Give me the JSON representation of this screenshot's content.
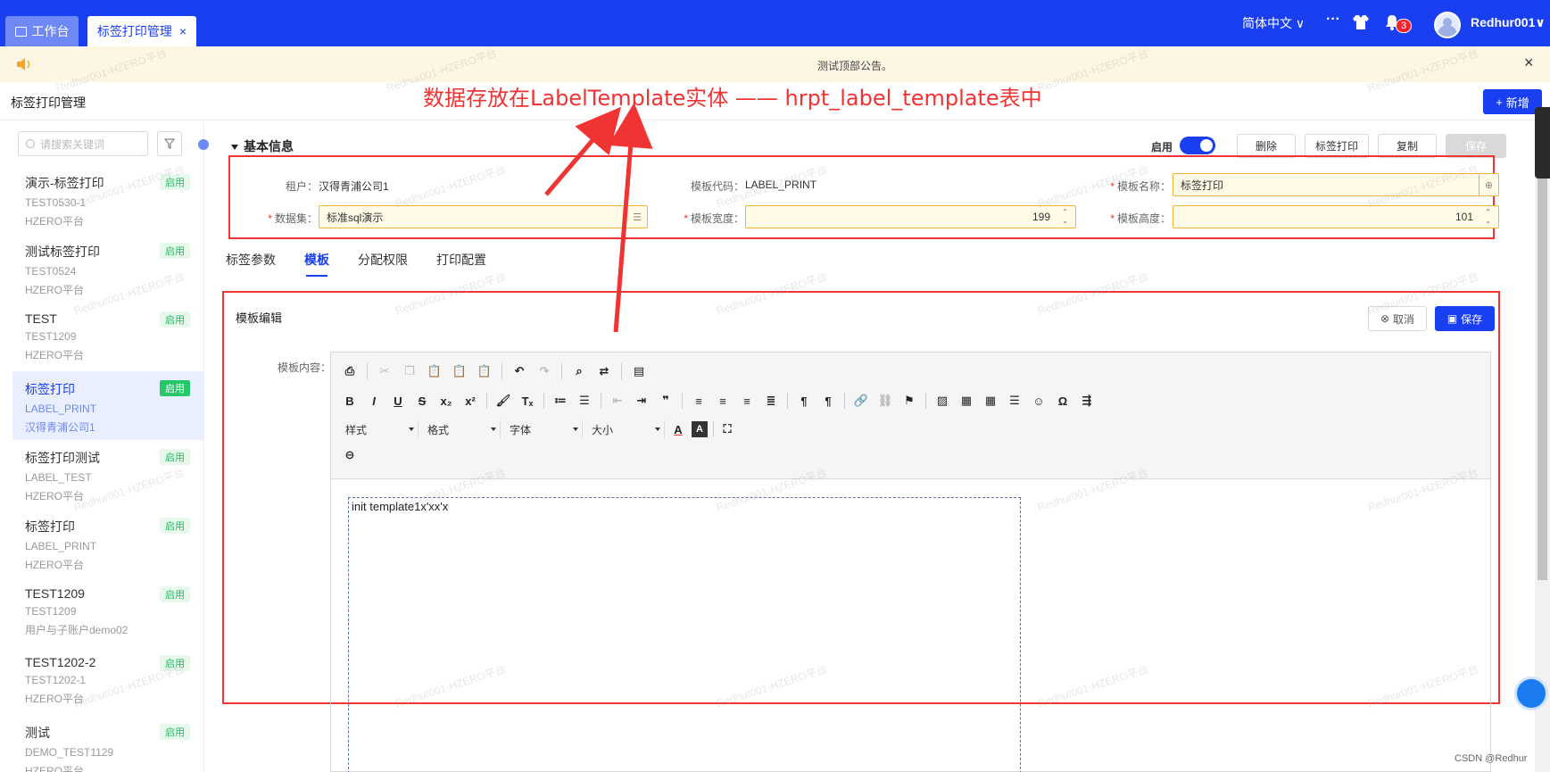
{
  "topbar": {
    "tabs": [
      {
        "label": "工作台"
      },
      {
        "label": "标签打印管理",
        "close": "×"
      }
    ],
    "language": "简体中文 ∨",
    "more": "···",
    "notification_count": "3",
    "username": "Redhur001∨"
  },
  "notice": {
    "text": "测试顶部公告。",
    "close": "×"
  },
  "page": {
    "title": "标签打印管理",
    "new_button": "新增"
  },
  "sidebar": {
    "search_placeholder": "请搜索关键词",
    "items": [
      {
        "name": "演示-标签打印",
        "code": "TEST0530-1",
        "tenant": "HZERO平台",
        "status": "启用"
      },
      {
        "name": "测试标签打印",
        "code": "TEST0524",
        "tenant": "HZERO平台",
        "status": "启用"
      },
      {
        "name": "TEST",
        "code": "TEST1209",
        "tenant": "HZERO平台",
        "status": "启用"
      },
      {
        "name": "标签打印",
        "code": "LABEL_PRINT",
        "tenant": "汉得青浦公司1",
        "status": "启用",
        "active": true
      },
      {
        "name": "标签打印测试",
        "code": "LABEL_TEST",
        "tenant": "HZERO平台",
        "status": "启用"
      },
      {
        "name": "标签打印",
        "code": "LABEL_PRINT",
        "tenant": "HZERO平台",
        "status": "启用"
      },
      {
        "name": "TEST1209",
        "code": "TEST1209",
        "tenant": "用户与子账户demo02",
        "status": "启用"
      },
      {
        "name": "TEST1202-2",
        "code": "TEST1202-1",
        "tenant": "HZERO平台",
        "status": "启用"
      },
      {
        "name": "测试",
        "code": "DEMO_TEST1129",
        "tenant": "HZERO平台",
        "status": "启用"
      }
    ]
  },
  "basic_info": {
    "title": "基本信息",
    "enable_label": "启用",
    "enabled": true,
    "buttons": {
      "delete": "删除",
      "print": "标签打印",
      "copy": "复制",
      "save": "保存"
    },
    "fields": {
      "tenant_label": "租户：",
      "tenant_value": "汉得青浦公司1",
      "template_code_label": "模板代码：",
      "template_code_value": "LABEL_PRINT",
      "template_name_label": "模板名称：",
      "template_name_value": "标签打印",
      "dataset_label": "数据集：",
      "dataset_value": "标准sql演示",
      "width_label": "模板宽度：",
      "width_value": "199",
      "height_label": "模板高度：",
      "height_value": "101"
    }
  },
  "subtabs": [
    "标签参数",
    "模板",
    "分配权限",
    "打印配置"
  ],
  "active_subtab": "模板",
  "editor": {
    "title": "模板编辑",
    "cancel": "取消",
    "save": "保存",
    "content_label": "模板内容：",
    "selects": [
      "样式",
      "格式",
      "字体",
      "大小"
    ],
    "content": "init template1x'xx'x"
  },
  "annotation": {
    "text": "数据存放在LabelTemplate实体 —— hrpt_label_template表中",
    "color": "#f03333"
  },
  "watermark": "Redhur001-HZERO平台",
  "footer": "CSDN @Redhur",
  "colors": {
    "primary": "#1a3ff0",
    "success": "#28c66b",
    "warning_border": "#f7b23b",
    "annotation": "#f03333"
  }
}
